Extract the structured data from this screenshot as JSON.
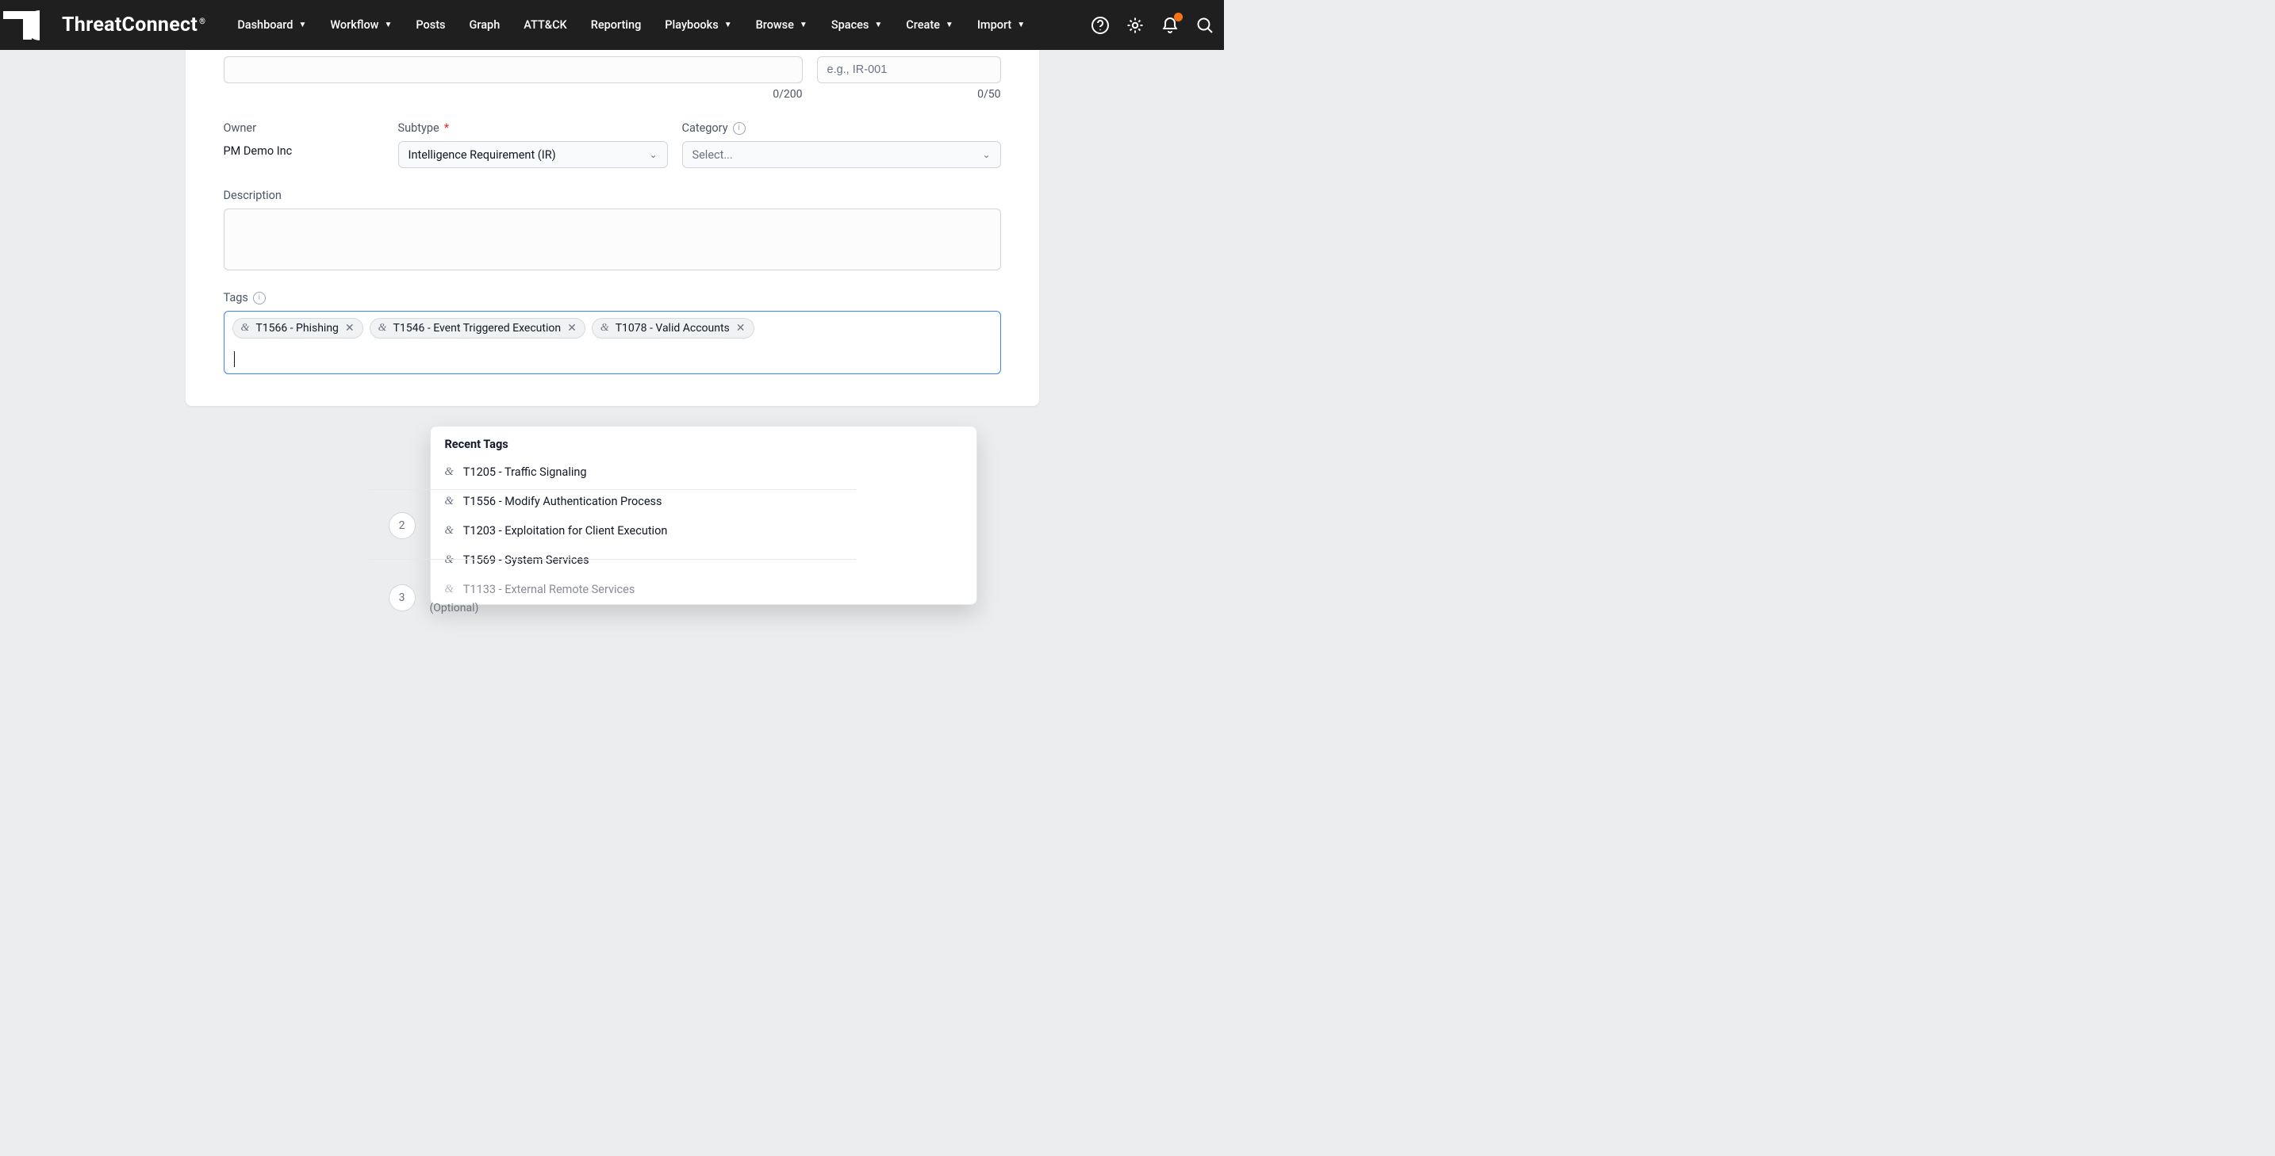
{
  "brand": "ThreatConnect",
  "nav": [
    {
      "label": "Dashboard",
      "caret": true
    },
    {
      "label": "Workflow",
      "caret": true
    },
    {
      "label": "Posts",
      "caret": false
    },
    {
      "label": "Graph",
      "caret": false
    },
    {
      "label": "ATT&CK",
      "caret": false
    },
    {
      "label": "Reporting",
      "caret": false
    },
    {
      "label": "Playbooks",
      "caret": true
    },
    {
      "label": "Browse",
      "caret": true
    },
    {
      "label": "Spaces",
      "caret": true
    },
    {
      "label": "Create",
      "caret": true
    },
    {
      "label": "Import",
      "caret": true
    }
  ],
  "fields": {
    "name_counter": "0/200",
    "id_placeholder": "e.g., IR-001",
    "id_counter": "0/50",
    "owner_label": "Owner",
    "owner_value": "PM Demo Inc",
    "subtype_label": "Subtype",
    "subtype_value": "Intelligence Requirement (IR)",
    "category_label": "Category",
    "category_placeholder": "Select...",
    "description_label": "Description",
    "tags_label": "Tags"
  },
  "tags": [
    "T1566 - Phishing",
    "T1546 - Event Triggered Execution",
    "T1078 - Valid Accounts"
  ],
  "dropdown": {
    "header": "Recent Tags",
    "items": [
      "T1205 - Traffic Signaling",
      "T1556 - Modify Authentication Process",
      "T1203 - Exploitation for Client Execution",
      "T1569 - System Services",
      "T1133 - External Remote Services"
    ]
  },
  "steps": {
    "s2": "2",
    "s3": "3"
  },
  "optional": "(Optional)"
}
